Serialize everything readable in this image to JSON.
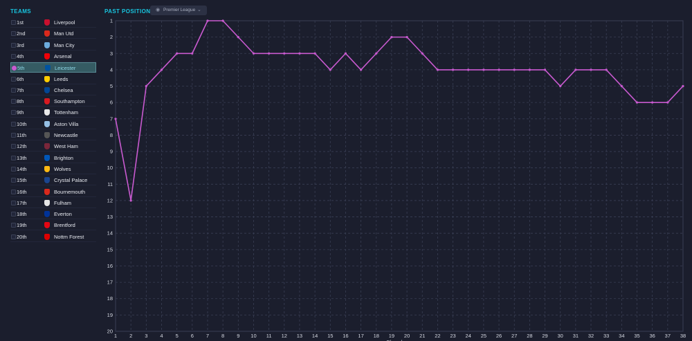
{
  "teams_panel": {
    "title": "TEAMS",
    "teams": [
      {
        "pos": "1st",
        "name": "Liverpool",
        "color": "#c8102e"
      },
      {
        "pos": "2nd",
        "name": "Man Utd",
        "color": "#da291c"
      },
      {
        "pos": "3rd",
        "name": "Man City",
        "color": "#6cabdd"
      },
      {
        "pos": "4th",
        "name": "Arsenal",
        "color": "#ef0107"
      },
      {
        "pos": "5th",
        "name": "Leicester",
        "color": "#0053a0",
        "selected": true
      },
      {
        "pos": "6th",
        "name": "Leeds",
        "color": "#ffcd00"
      },
      {
        "pos": "7th",
        "name": "Chelsea",
        "color": "#034694"
      },
      {
        "pos": "8th",
        "name": "Southampton",
        "color": "#d71920"
      },
      {
        "pos": "9th",
        "name": "Tottenham",
        "color": "#e8e8e8"
      },
      {
        "pos": "10th",
        "name": "Aston Villa",
        "color": "#95bfe5"
      },
      {
        "pos": "11th",
        "name": "Newcastle",
        "color": "#555555"
      },
      {
        "pos": "12th",
        "name": "West Ham",
        "color": "#7a263a"
      },
      {
        "pos": "13th",
        "name": "Brighton",
        "color": "#0057b8"
      },
      {
        "pos": "14th",
        "name": "Wolves",
        "color": "#fdb913"
      },
      {
        "pos": "15th",
        "name": "Crystal Palace",
        "color": "#1b458f"
      },
      {
        "pos": "16th",
        "name": "Bournemouth",
        "color": "#da291c"
      },
      {
        "pos": "17th",
        "name": "Fulham",
        "color": "#e6e6e6"
      },
      {
        "pos": "18th",
        "name": "Everton",
        "color": "#003399"
      },
      {
        "pos": "19th",
        "name": "Brentford",
        "color": "#e30613"
      },
      {
        "pos": "20th",
        "name": "Nottm Forest",
        "color": "#dd0000"
      }
    ]
  },
  "chart_header": {
    "title": "PAST POSITIONS",
    "competition": "Premier League",
    "competition_icon": "eye-icon",
    "dropdown_icon": "chevron-down-icon"
  },
  "chart_data": {
    "type": "line",
    "title": "PAST POSITIONS",
    "xlabel": "Played",
    "ylabel": "",
    "x": [
      1,
      2,
      3,
      4,
      5,
      6,
      7,
      8,
      9,
      10,
      11,
      12,
      13,
      14,
      15,
      16,
      17,
      18,
      19,
      20,
      21,
      22,
      23,
      24,
      25,
      26,
      27,
      28,
      29,
      30,
      31,
      32,
      33,
      34,
      35,
      36,
      37,
      38
    ],
    "xlim": [
      1,
      38
    ],
    "ylim": [
      20,
      1
    ],
    "y_inverted": true,
    "yticks": [
      1,
      2,
      3,
      4,
      5,
      6,
      7,
      8,
      9,
      10,
      11,
      12,
      13,
      14,
      15,
      16,
      17,
      18,
      19,
      20
    ],
    "grid": true,
    "series": [
      {
        "color": "#c95ad0",
        "values": [
          7,
          12,
          5,
          4,
          3,
          3,
          1,
          1,
          2,
          3,
          3,
          3,
          3,
          3,
          4,
          3,
          4,
          3,
          2,
          2,
          3,
          4,
          4,
          4,
          4,
          4,
          4,
          4,
          4,
          5,
          4,
          4,
          4,
          5,
          6,
          6,
          6,
          5
        ]
      }
    ]
  }
}
